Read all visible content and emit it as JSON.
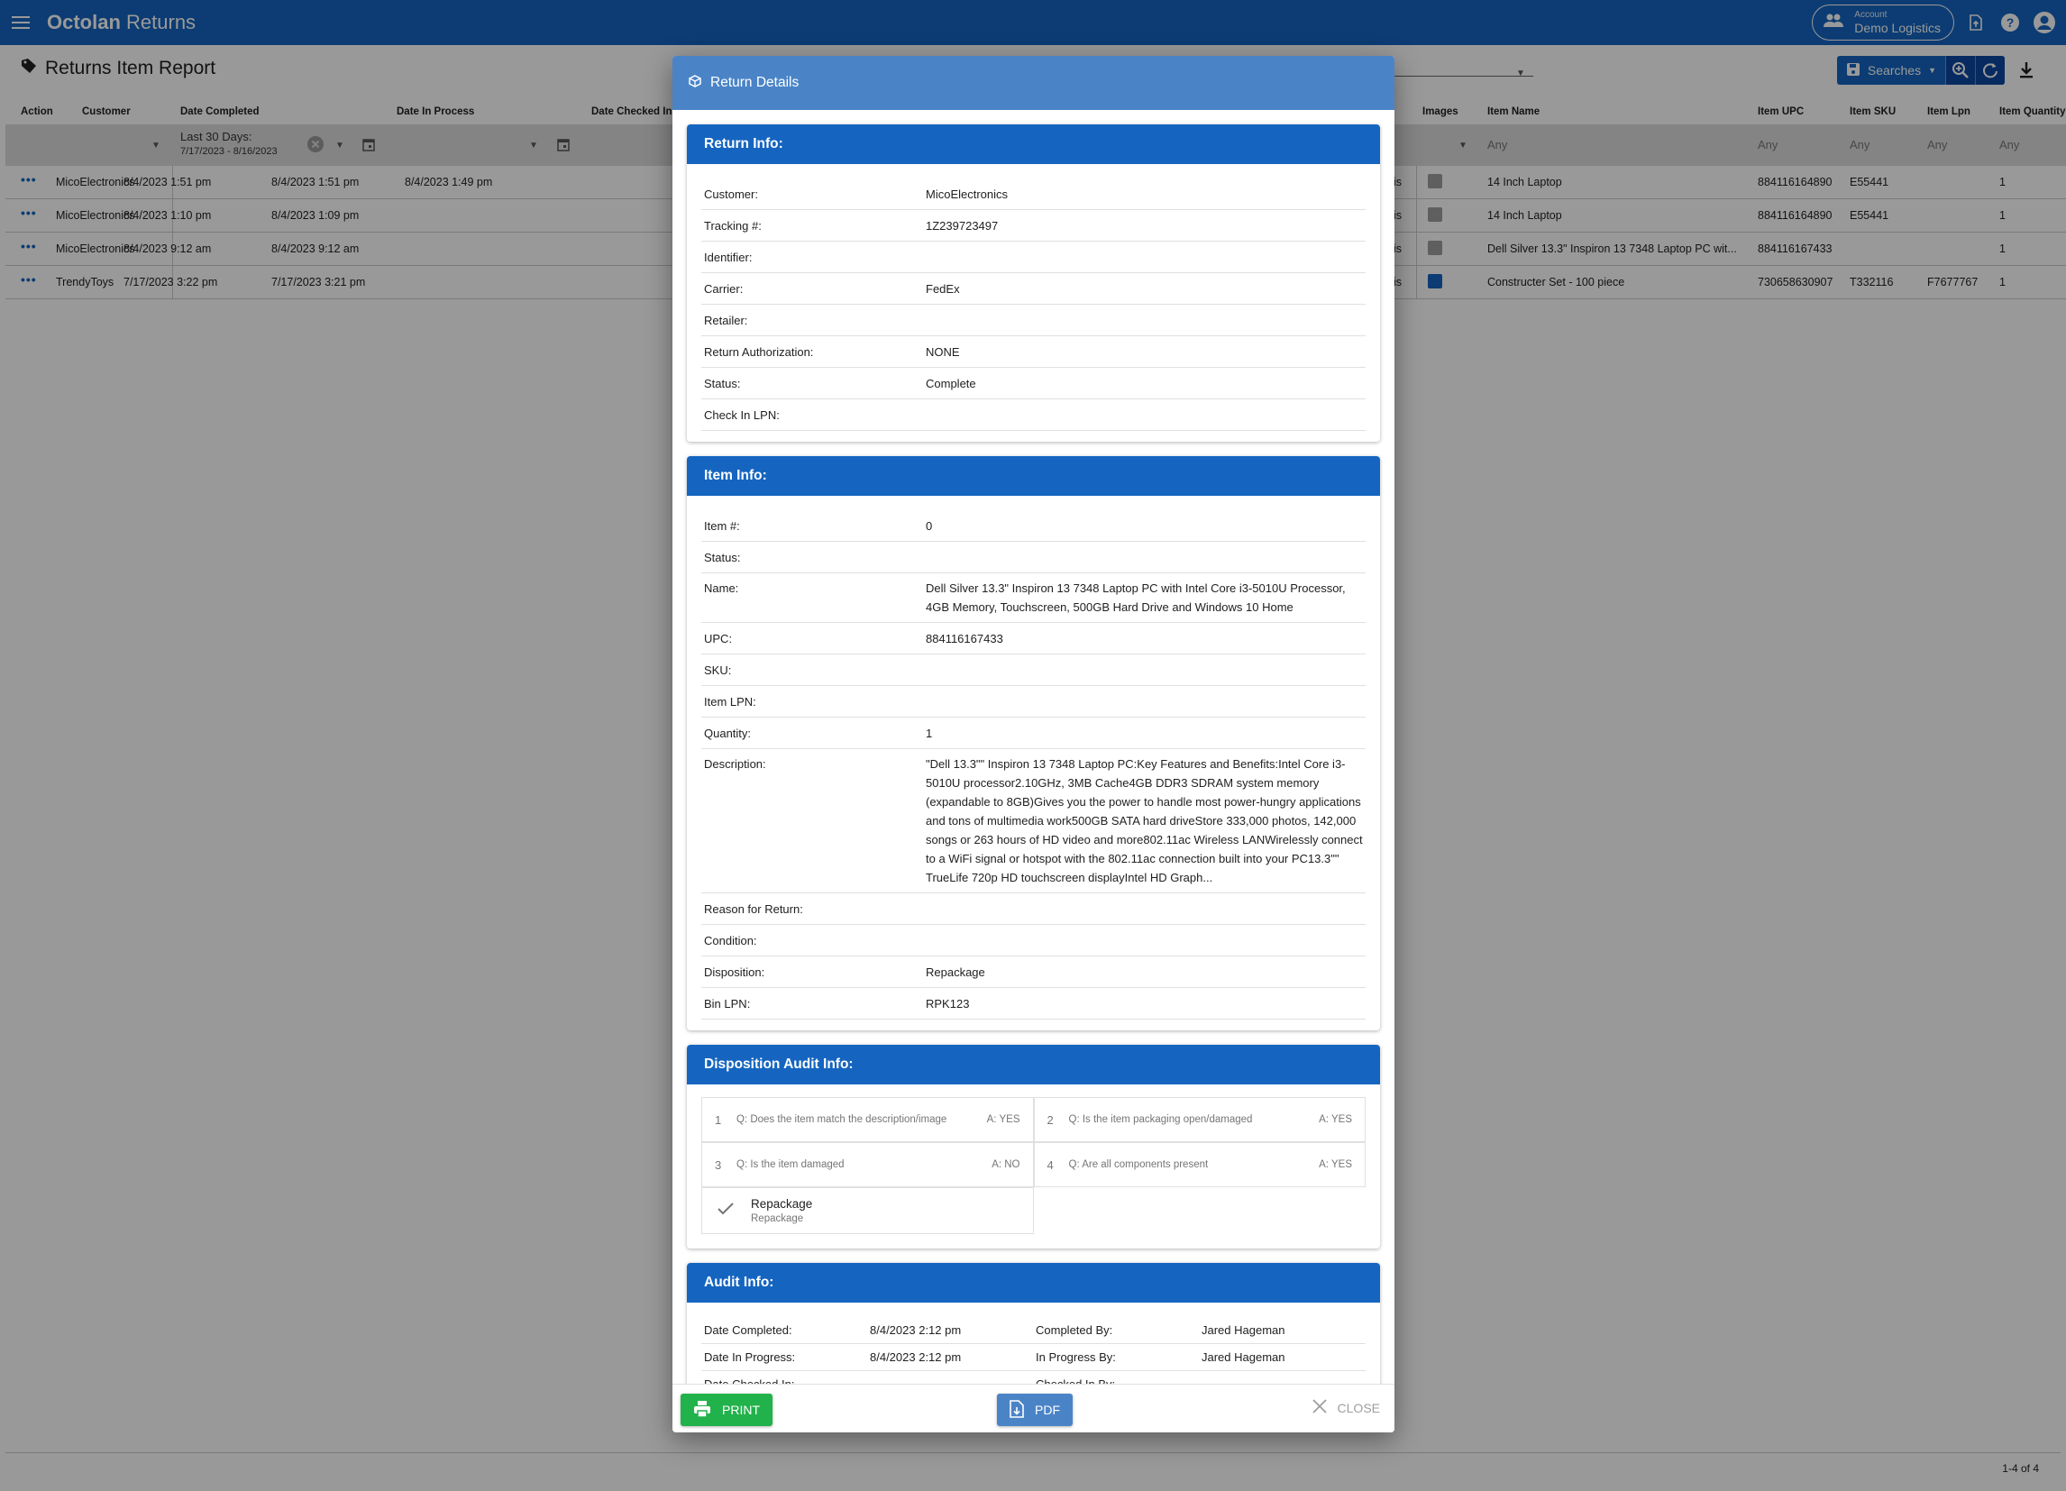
{
  "app": {
    "brand_bold": "Octolan",
    "brand_light": " Returns",
    "account_label": "Account",
    "account_value": "Demo Logistics"
  },
  "page": {
    "title": "Returns Item Report",
    "searches_label": "Searches",
    "pager_text": "1-4 of 4"
  },
  "grid": {
    "columns": [
      "Action",
      "Customer",
      "Date Completed",
      "Date In Process",
      "Date Checked In",
      "Images",
      "Item Name",
      "Item UPC",
      "Item SKU",
      "Item Lpn",
      "Item Quantity"
    ],
    "filters": {
      "date_completed_label": "Last 30 Days:",
      "date_completed_range": "7/17/2023 - 8/16/2023",
      "any": "Any"
    },
    "rows": [
      {
        "action": "•••",
        "customer": "MicoElectronics",
        "date_completed": "8/4/2023 1:51 pm",
        "date_in_process": "8/4/2023 1:51 pm",
        "date_checked_in": "8/4/2023 1:49 pm",
        "status_fragment": "is",
        "has_image": false,
        "item_name": "14 Inch Laptop",
        "upc": "884116164890",
        "sku": "E55441",
        "lpn": "",
        "qty": "1"
      },
      {
        "action": "•••",
        "customer": "MicoElectronics",
        "date_completed": "8/4/2023 1:10 pm",
        "date_in_process": "8/4/2023 1:09 pm",
        "date_checked_in": "",
        "status_fragment": "is",
        "has_image": false,
        "item_name": "14 Inch Laptop",
        "upc": "884116164890",
        "sku": "E55441",
        "lpn": "",
        "qty": "1"
      },
      {
        "action": "•••",
        "customer": "MicoElectronics",
        "date_completed": "8/4/2023 9:12 am",
        "date_in_process": "8/4/2023 9:12 am",
        "date_checked_in": "",
        "status_fragment": "is",
        "has_image": false,
        "item_name": "Dell Silver 13.3\" Inspiron 13 7348 Laptop PC wit...",
        "upc": "884116167433",
        "sku": "",
        "lpn": "",
        "qty": "1"
      },
      {
        "action": "•••",
        "customer": "TrendyToys",
        "date_completed": "7/17/2023 3:22 pm",
        "date_in_process": "7/17/2023 3:21 pm",
        "date_checked_in": "",
        "status_fragment": "is",
        "has_image": true,
        "item_name": "Constructer Set - 100 piece",
        "upc": "730658630907",
        "sku": "T332116",
        "lpn": "F7677767",
        "qty": "1"
      }
    ]
  },
  "dialog": {
    "title": "Return Details",
    "return_info": {
      "heading": "Return Info:",
      "fields": [
        {
          "label": "Customer:",
          "value": "MicoElectronics"
        },
        {
          "label": "Tracking #:",
          "value": "1Z239723497"
        },
        {
          "label": "Identifier:",
          "value": ""
        },
        {
          "label": "Carrier:",
          "value": "FedEx"
        },
        {
          "label": "Retailer:",
          "value": ""
        },
        {
          "label": "Return Authorization:",
          "value": "NONE"
        },
        {
          "label": "Status:",
          "value": "Complete"
        },
        {
          "label": "Check In LPN:",
          "value": ""
        }
      ]
    },
    "item_info": {
      "heading": "Item Info:",
      "fields": [
        {
          "label": "Item #:",
          "value": "0"
        },
        {
          "label": "Status:",
          "value": ""
        },
        {
          "label": "Name:",
          "value": "Dell Silver 13.3\" Inspiron 13 7348 Laptop PC with Intel Core i3-5010U Processor, 4GB Memory, Touchscreen, 500GB Hard Drive and Windows 10 Home"
        },
        {
          "label": "UPC:",
          "value": "884116167433"
        },
        {
          "label": "SKU:",
          "value": ""
        },
        {
          "label": "Item LPN:",
          "value": ""
        },
        {
          "label": "Quantity:",
          "value": "1"
        },
        {
          "label": "Description:",
          "value": "\"Dell 13.3\"\" Inspiron 13 7348 Laptop PC:Key Features and Benefits:Intel Core i3-5010U processor2.10GHz, 3MB Cache4GB DDR3 SDRAM system memory (expandable to 8GB)Gives you the power to handle most power-hungry applications and tons of multimedia work500GB SATA hard driveStore 333,000 photos, 142,000 songs or 263 hours of HD video and more802.11ac Wireless LANWirelessly connect to a WiFi signal or hotspot with the 802.11ac connection built into your PC13.3\"\" TrueLife 720p HD touchscreen displayIntel HD Graph..."
        },
        {
          "label": "Reason for Return:",
          "value": ""
        },
        {
          "label": "Condition:",
          "value": ""
        },
        {
          "label": "Disposition:",
          "value": "Repackage"
        },
        {
          "label": "Bin LPN:",
          "value": "RPK123"
        }
      ]
    },
    "disposition_audit": {
      "heading": "Disposition Audit Info:",
      "questions": [
        {
          "n": "1",
          "q": "Q: Does the item match the description/image",
          "a": "A: YES"
        },
        {
          "n": "2",
          "q": "Q: Is the item packaging open/damaged",
          "a": "A: YES"
        },
        {
          "n": "3",
          "q": "Q: Is the item damaged",
          "a": "A: NO"
        },
        {
          "n": "4",
          "q": "Q: Are all components present",
          "a": "A: YES"
        }
      ],
      "result_title": "Repackage",
      "result_subtitle": "Repackage"
    },
    "audit_info": {
      "heading": "Audit Info:",
      "rows": [
        {
          "l1": "Date Completed:",
          "v1": "8/4/2023 2:12 pm",
          "l2": "Completed By:",
          "v2": "Jared Hageman"
        },
        {
          "l1": "Date In Progress:",
          "v1": "8/4/2023 2:12 pm",
          "l2": "In Progress By:",
          "v2": "Jared Hageman"
        },
        {
          "l1": "Date Checked In:",
          "v1": "",
          "l2": "Checked In By:",
          "v2": ""
        }
      ]
    },
    "footer": {
      "print_label": "PRINT",
      "pdf_label": "PDF",
      "close_label": "CLOSE"
    }
  },
  "colors": {
    "primary": "#1565c0",
    "dialog_header": "#4a84c7",
    "print_green": "#22b24c"
  }
}
